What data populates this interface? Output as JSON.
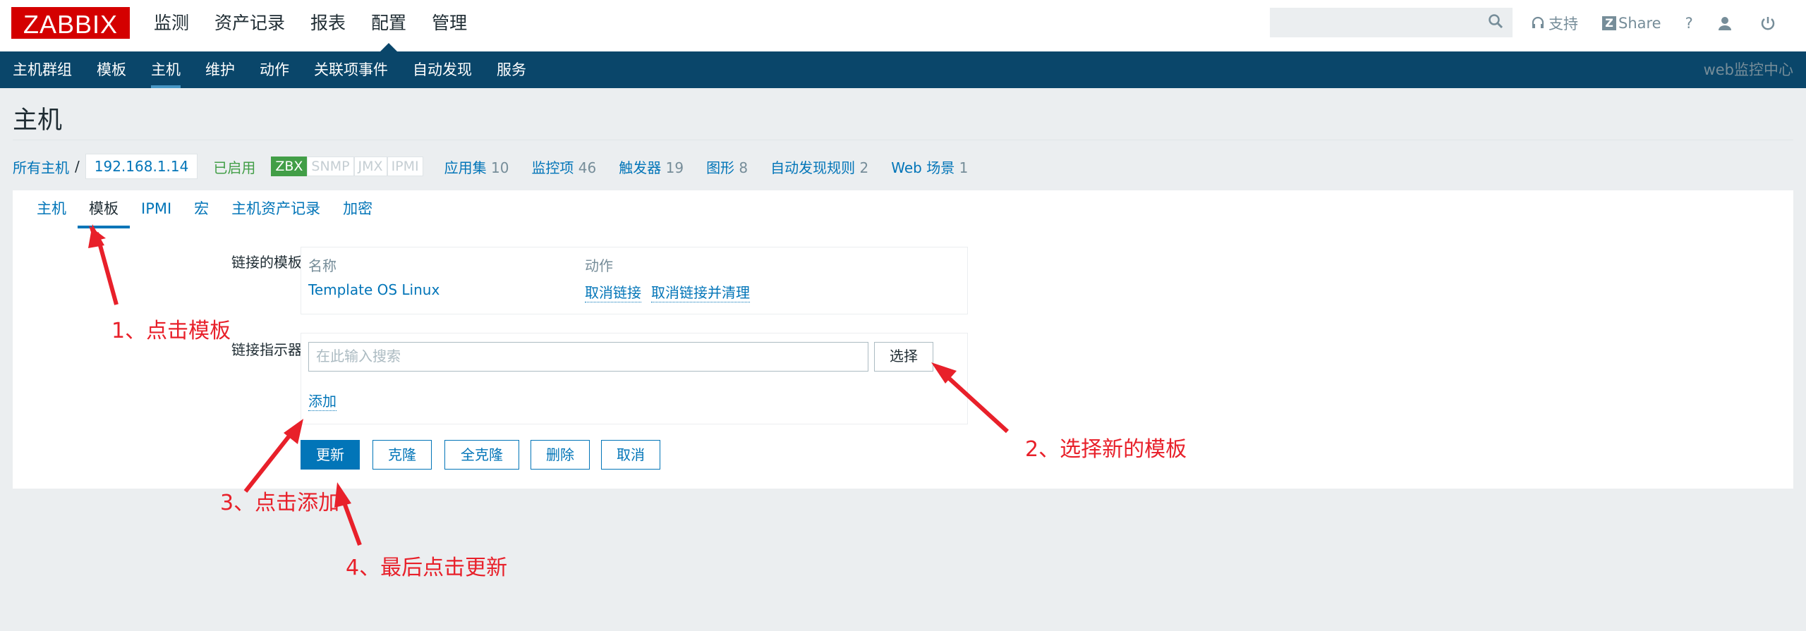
{
  "brand": {
    "logo_text": "ZABBIX",
    "accent": "#d40000"
  },
  "main_nav": [
    "监测",
    "资产记录",
    "报表",
    "配置",
    "管理"
  ],
  "main_nav_active": "配置",
  "search": {
    "placeholder": ""
  },
  "top_links": {
    "support": "支持",
    "share": "Share",
    "help": "?"
  },
  "sub_nav": [
    "主机群组",
    "模板",
    "主机",
    "维护",
    "动作",
    "关联项事件",
    "自动发现",
    "服务"
  ],
  "sub_nav_active": "主机",
  "sub_nav_right": "web监控中心",
  "page_title": "主机",
  "breadcrumb": {
    "all_hosts": "所有主机",
    "separator": "/",
    "host": "192.168.1.14",
    "status": "已启用",
    "availability": [
      "ZBX",
      "SNMP",
      "JMX",
      "IPMI"
    ],
    "counts": [
      {
        "label": "应用集",
        "value": "10"
      },
      {
        "label": "监控项",
        "value": "46"
      },
      {
        "label": "触发器",
        "value": "19"
      },
      {
        "label": "图形",
        "value": "8"
      },
      {
        "label": "自动发现规则",
        "value": "2"
      },
      {
        "label": "Web 场景",
        "value": "1"
      }
    ]
  },
  "tabs": [
    "主机",
    "模板",
    "IPMI",
    "宏",
    "主机资产记录",
    "加密"
  ],
  "tabs_active": "模板",
  "form": {
    "linked_templates_label": "链接的模板",
    "col_name": "名称",
    "col_action": "动作",
    "template_name": "Template OS Linux",
    "unlink": "取消链接",
    "unlink_clear": "取消链接并清理",
    "link_indicator_label": "链接指示器",
    "search_placeholder": "在此输入搜索",
    "select_button": "选择",
    "add_link": "添加"
  },
  "buttons": {
    "update": "更新",
    "clone": "克隆",
    "full_clone": "全克隆",
    "delete": "删除",
    "cancel": "取消"
  },
  "annotations": {
    "step1": "1、点击模板",
    "step2": "2、选择新的模板",
    "step3": "3、点击添加",
    "step4": "4、最后点击更新"
  },
  "colors": {
    "nav_bg": "#0a466a",
    "link": "#0275b8",
    "enabled": "#429e47",
    "annotation": "#e8202a"
  }
}
